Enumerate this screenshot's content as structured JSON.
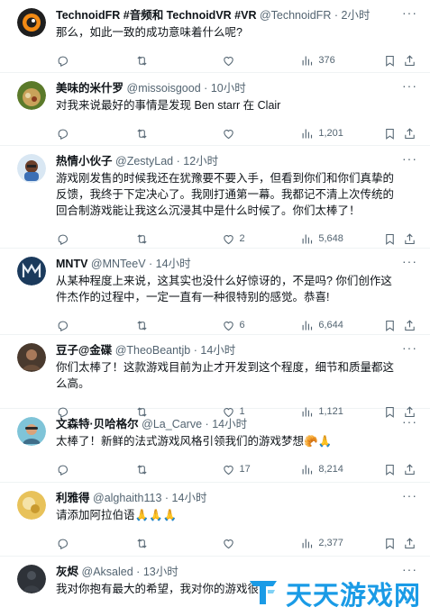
{
  "tweets": [
    {
      "name": "TechnoidFR #音频和 TechnoidVR #VR",
      "handle": "@TechnoidFR",
      "time": "2小时",
      "text": "那么，如此一致的成功意味着什么呢?",
      "reply": "",
      "retweet": "",
      "like": "",
      "views": "376"
    },
    {
      "name": "美味的米什罗",
      "handle": "@missoisgood",
      "time": "10小时",
      "text": "对我来说最好的事情是发现 Ben starr 在 Clair",
      "reply": "",
      "retweet": "",
      "like": "",
      "views": "1,201"
    },
    {
      "name": "热情小伙子",
      "handle": "@ZestyLad",
      "time": "12小时",
      "text": "游戏刚发售的时候我还在犹豫要不要入手，但看到你们和你们真挚的反馈，我终于下定决心了。我刚打通第一幕。我都记不清上次传统的回合制游戏能让我这么沉浸其中是什么时候了。你们太棒了！",
      "reply": "",
      "retweet": "",
      "like": "2",
      "views": "5,648"
    },
    {
      "name": "MNTV",
      "handle": "@MNTeeV",
      "time": "14小时",
      "text": "从某种程度上来说，这其实也没什么好惊讶的，不是吗? 你们创作这件杰作的过程中，一定一直有一种很特别的感觉。恭喜!",
      "reply": "",
      "retweet": "",
      "like": "6",
      "views": "6,644"
    },
    {
      "name": "豆子@金碟",
      "handle": "@TheoBeantjb",
      "time": "14小时",
      "text": "你们太棒了！这款游戏目前为止才开发到这个程度，细节和质量都这么高。",
      "reply": "",
      "retweet": "",
      "like": "1",
      "views": "1,121"
    },
    {
      "name": "文森特·贝哈格尔",
      "handle": "@La_Carve",
      "time": "14小时",
      "text": "太棒了！新鲜的法式游戏风格引领我们的游戏梦想🥐🙏",
      "reply": "",
      "retweet": "",
      "like": "17",
      "views": "8,214"
    },
    {
      "name": "利雅得",
      "handle": "@alghaith113",
      "time": "14小时",
      "text": "请添加阿拉伯语🙏🙏🙏",
      "reply": "",
      "retweet": "",
      "like": "",
      "views": "2,377"
    },
    {
      "name": "灰烬",
      "handle": "@Aksaled",
      "time": "13小时",
      "text": "我对你抱有最大的希望，我对你的游戏很",
      "reply": "",
      "retweet": "",
      "like": "",
      "views": ""
    }
  ],
  "watermark": {
    "text": "天天游戏网"
  },
  "icons": {
    "reply": "reply-icon",
    "retweet": "retweet-icon",
    "like": "like-icon",
    "views": "views-icon",
    "bookmark": "bookmark-icon",
    "share": "share-icon",
    "more": "more-icon"
  },
  "colors": {
    "text": "#0f1419",
    "muted": "#536471",
    "divider": "#eff3f4",
    "watermark": "#1a9be6"
  }
}
